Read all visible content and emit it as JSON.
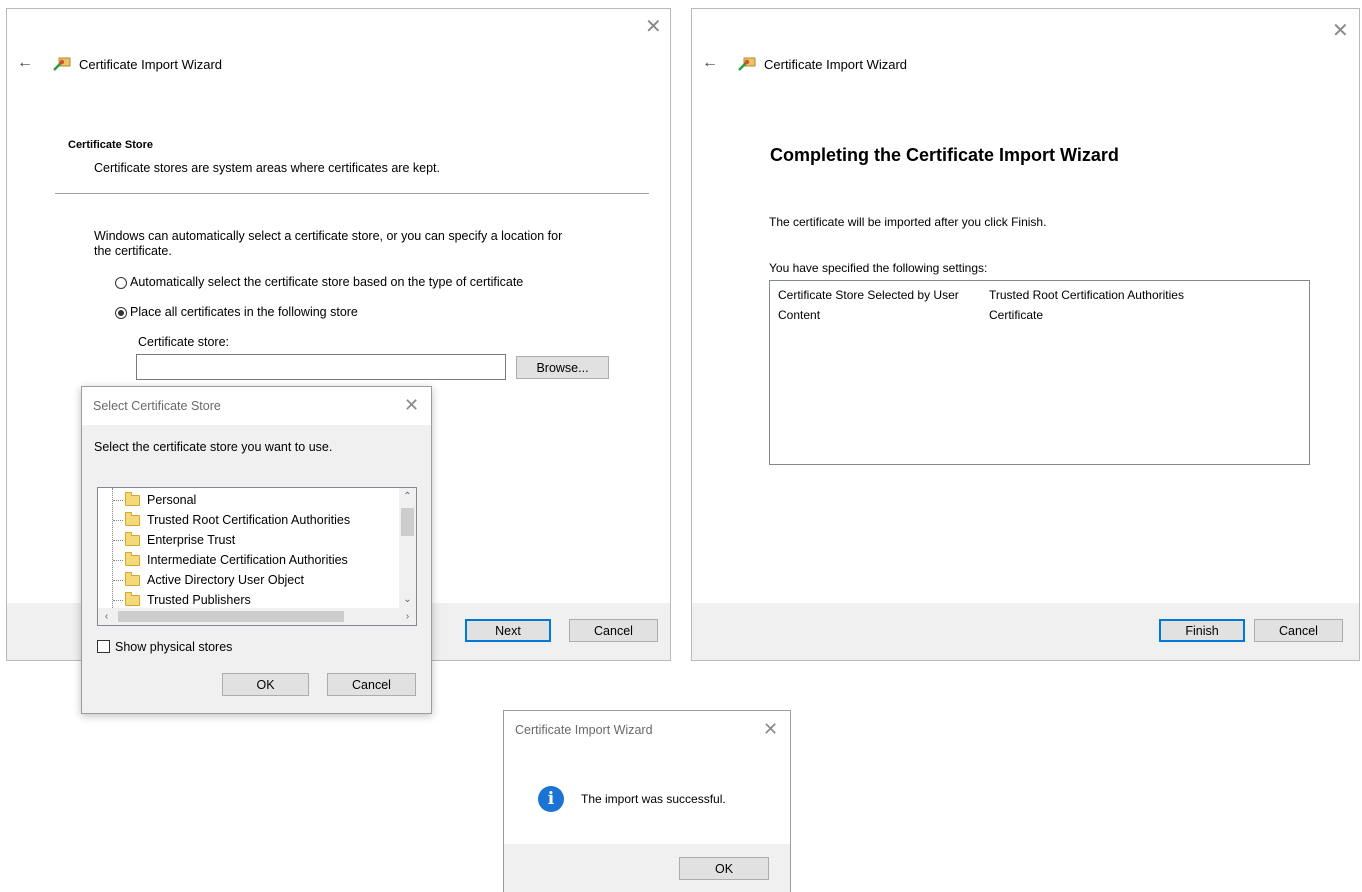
{
  "wizard_left": {
    "title": "Certificate Import Wizard",
    "section_heading": "Certificate Store",
    "section_desc": "Certificate stores are system areas where certificates are kept.",
    "intro_line1": "Windows can automatically select a certificate store, or you can specify a location for",
    "intro_line2": "the certificate.",
    "radio_auto": "Automatically select the certificate store based on the type of certificate",
    "radio_place": "Place all certificates in the following store",
    "store_label": "Certificate store:",
    "store_value": "",
    "browse_label": "Browse...",
    "next_label": "Next",
    "cancel_label": "Cancel"
  },
  "select_store_dialog": {
    "title": "Select Certificate Store",
    "prompt": "Select the certificate store you want to use.",
    "stores": [
      "Personal",
      "Trusted Root Certification Authorities",
      "Enterprise Trust",
      "Intermediate Certification Authorities",
      "Active Directory User Object",
      "Trusted Publishers"
    ],
    "show_physical_label": "Show physical stores",
    "ok_label": "OK",
    "cancel_label": "Cancel"
  },
  "wizard_right": {
    "title": "Certificate Import Wizard",
    "heading": "Completing the Certificate Import Wizard",
    "info_text": "The certificate will be imported after you click Finish.",
    "settings_label": "You have specified the following settings:",
    "settings": [
      {
        "key": "Certificate Store Selected by User",
        "value": "Trusted Root Certification Authorities"
      },
      {
        "key": "Content",
        "value": "Certificate"
      }
    ],
    "finish_label": "Finish",
    "cancel_label": "Cancel"
  },
  "success_dialog": {
    "title": "Certificate Import Wizard",
    "message": "The import was successful.",
    "ok_label": "OK"
  },
  "colors": {
    "accent": "#0078d7",
    "info_icon": "#1b74d3",
    "footer_bg": "#f0f0f0"
  }
}
